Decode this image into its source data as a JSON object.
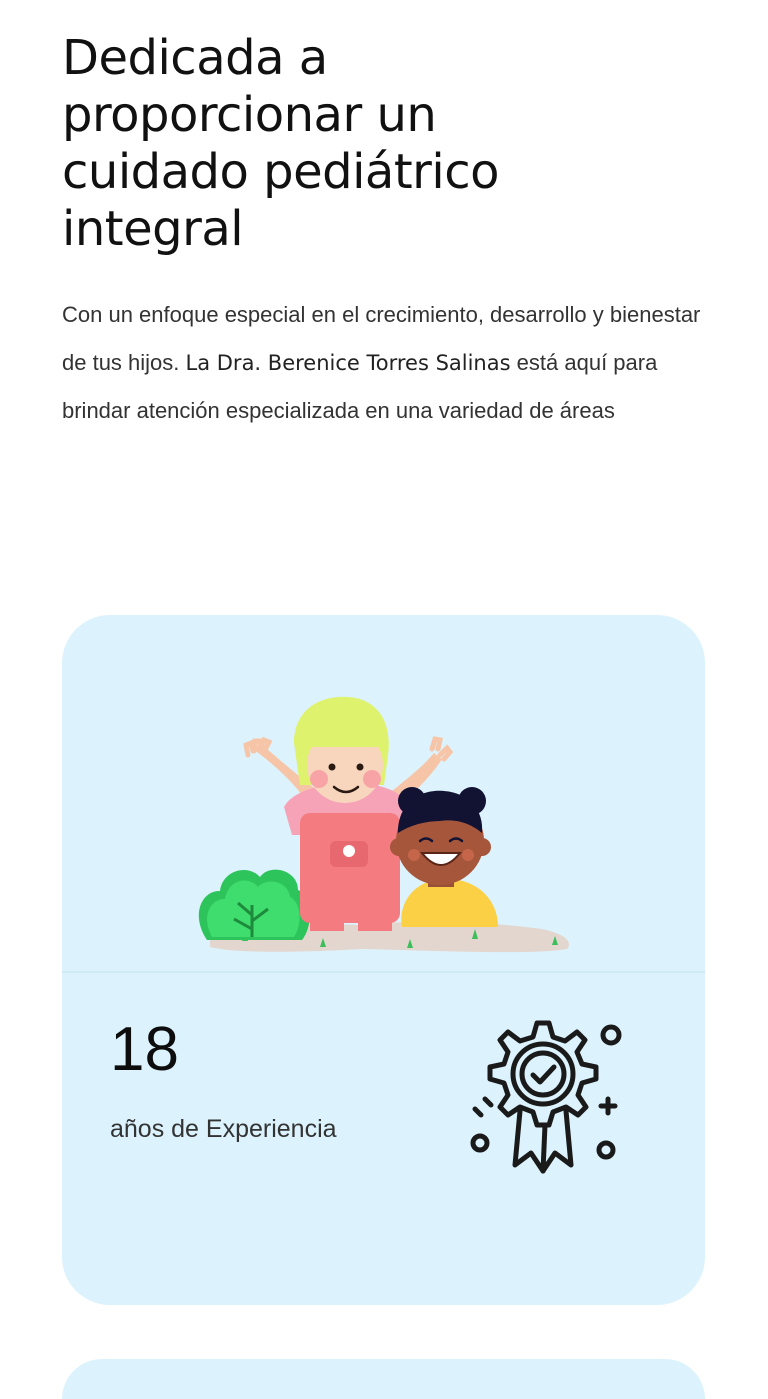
{
  "hero": {
    "title": "Dedicada a proporcionar un cuidado pediátrico integral",
    "body_before": "Con un enfoque especial en el crecimiento, desarrollo y bienestar de tus hijos. ",
    "doctor_name": "La Dra. Berenice Torres Salinas",
    "body_after": " está aquí para brindar atención especializada en una variedad de áreas"
  },
  "stats_card": {
    "number": "18",
    "label": "años de Experiencia",
    "icon": "award-gear-icon",
    "illustration": "two-children-waving-illustration",
    "background_color": "#dcf3fd"
  }
}
